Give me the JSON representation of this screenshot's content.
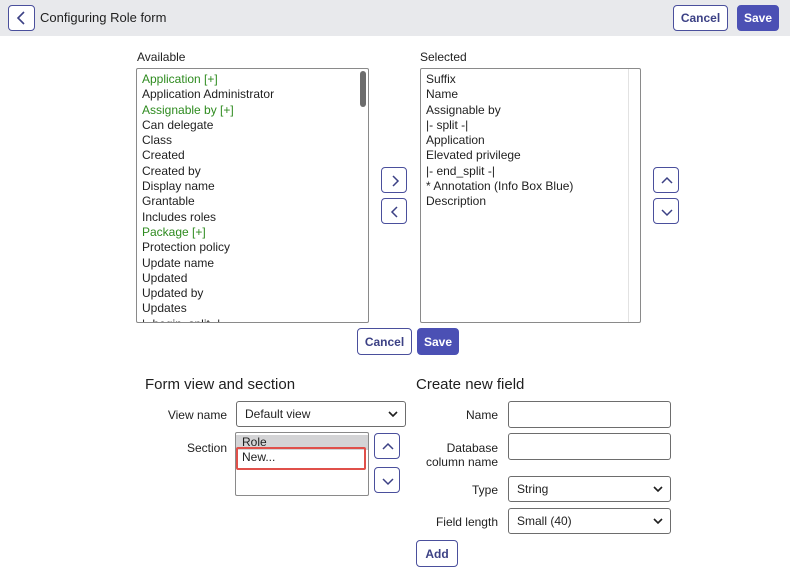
{
  "header": {
    "title": "Configuring Role form",
    "cancel_label": "Cancel",
    "save_label": "Save"
  },
  "available": {
    "label": "Available",
    "items": [
      {
        "text": "Application [+]",
        "green": true
      },
      {
        "text": "Application Administrator",
        "green": false
      },
      {
        "text": "Assignable by [+]",
        "green": true
      },
      {
        "text": "Can delegate",
        "green": false
      },
      {
        "text": "Class",
        "green": false
      },
      {
        "text": "Created",
        "green": false
      },
      {
        "text": "Created by",
        "green": false
      },
      {
        "text": "Display name",
        "green": false
      },
      {
        "text": "Grantable",
        "green": false
      },
      {
        "text": "Includes roles",
        "green": false
      },
      {
        "text": "Package [+]",
        "green": true
      },
      {
        "text": "Protection policy",
        "green": false
      },
      {
        "text": "Update name",
        "green": false
      },
      {
        "text": "Updated",
        "green": false
      },
      {
        "text": "Updated by",
        "green": false
      },
      {
        "text": "Updates",
        "green": false
      },
      {
        "text": "|- begin_split -|",
        "green": false
      }
    ]
  },
  "selected": {
    "label": "Selected",
    "items": [
      "Suffix",
      "Name",
      "Assignable by",
      "|- split -|",
      "Application",
      "Elevated privilege",
      "|- end_split -|",
      "* Annotation (Info Box Blue)",
      "Description"
    ]
  },
  "middle_buttons": {
    "cancel_label": "Cancel",
    "save_label": "Save"
  },
  "form_view": {
    "title": "Form view and section",
    "view_name_label": "View name",
    "view_name_value": "Default view",
    "section_label": "Section",
    "sections": [
      "Role",
      "New..."
    ]
  },
  "new_field": {
    "title": "Create new field",
    "name_label": "Name",
    "db_col_label_1": "Database",
    "db_col_label_2": "column name",
    "type_label": "Type",
    "type_value": "String",
    "field_length_label": "Field length",
    "field_length_value": "Small (40)",
    "add_label": "Add"
  },
  "colors": {
    "accent": "#4b50b4",
    "green_item": "#2e8b1f",
    "highlight": "#e0504a",
    "header_bg": "#e8e9ec"
  }
}
